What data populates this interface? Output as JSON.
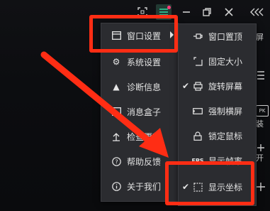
{
  "menu": {
    "items": [
      {
        "label": "窗口设置",
        "icon": "window-icon",
        "has_submenu": true
      },
      {
        "label": "系统设置",
        "icon": "gear-icon"
      },
      {
        "label": "诊断信息",
        "icon": "warning-icon"
      },
      {
        "label": "消息盒子",
        "icon": "message-box-icon"
      },
      {
        "label": "检查更新",
        "icon": "upload-arrow-icon"
      },
      {
        "label": "帮助反馈",
        "icon": "help-icon"
      },
      {
        "label": "关于我们",
        "icon": "info-icon"
      }
    ]
  },
  "submenu": {
    "items": [
      {
        "label": "窗口置顶",
        "icon": "pin-icon",
        "checked": false
      },
      {
        "label": "固定大小",
        "icon": "fixed-size-icon",
        "checked": false
      },
      {
        "label": "旋转屏幕",
        "icon": "rotate-screen-icon",
        "checked": true
      },
      {
        "label": "强制横屏",
        "icon": "landscape-icon",
        "checked": false
      },
      {
        "label": "锁定鼠标",
        "icon": "lock-icon",
        "checked": false
      },
      {
        "label": "显示帧率",
        "icon": "fps-icon",
        "icon_text": "FPS",
        "checked": false
      },
      {
        "label": "显示坐标",
        "icon": "coordinate-icon",
        "checked": true
      }
    ]
  },
  "right_strip": {
    "labels": [
      "屏",
      "",
      "",
      "装",
      "开",
      ""
    ]
  },
  "colors": {
    "accent": "#2fd7a2",
    "highlight": "#ff2d14",
    "notification": "#ff3c7a"
  }
}
